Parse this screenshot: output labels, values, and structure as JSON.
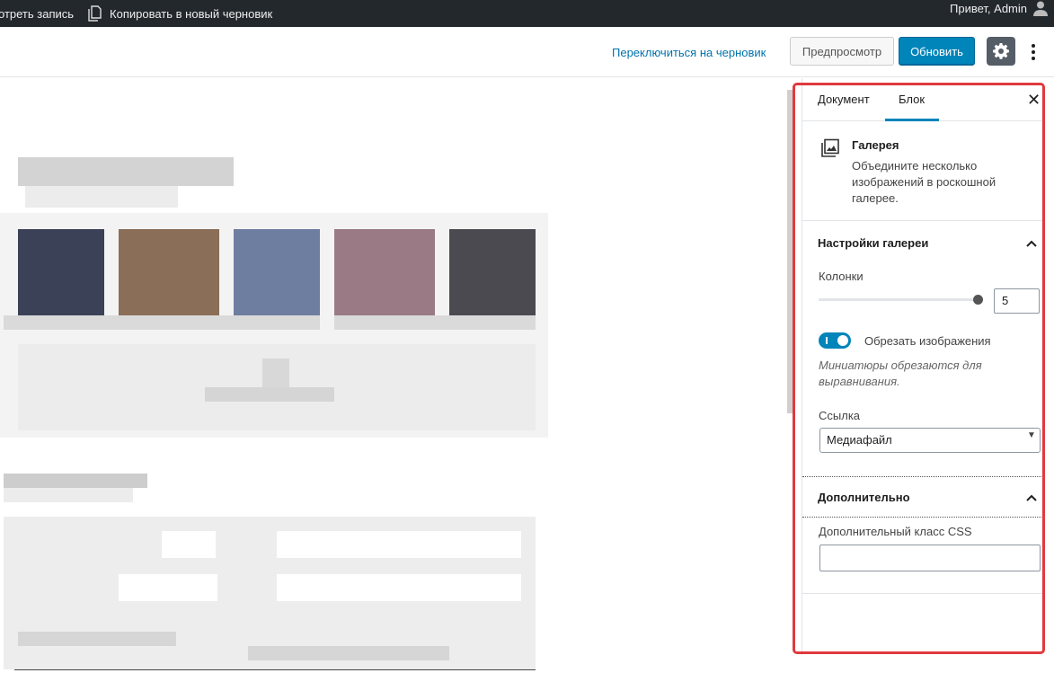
{
  "admin_bar": {
    "view_post": "отреть запись",
    "copy_draft": "Копировать в новый черновик",
    "greeting": "Привет, Admin",
    "icons": [
      "copy-icon",
      "user-icon"
    ]
  },
  "header": {
    "switch_draft": "Переключиться на черновик",
    "preview": "Предпросмотр",
    "update": "Обновить",
    "icons": [
      "gear-icon",
      "more-vertical-icon"
    ]
  },
  "sidebar": {
    "tabs": [
      "Документ",
      "Блок"
    ],
    "active_tab": "Блок",
    "close_icon": "close-icon",
    "block": {
      "icon": "gallery-icon",
      "title": "Галерея",
      "description": "Объедините несколько изображений в роскошной галерее."
    },
    "gallery_settings": {
      "title": "Настройки галереи",
      "columns_label": "Колонки",
      "columns_value": "5",
      "columns_level": 0.83,
      "crop_label": "Обрезать изображения",
      "crop_enabled": true,
      "crop_help": "Миниатюры обрезаются для выравнивания.",
      "link_label": "Ссылка",
      "link_value": "Медиафайл"
    },
    "advanced": {
      "title": "Дополнительно",
      "css_label": "Дополнительный класс CSS",
      "css_value": ""
    }
  },
  "colors": {
    "admin_bar_bg": "#23282d",
    "primary": "#0085ba",
    "link": "#0073aa",
    "highlight_frame": "#e03a3e"
  }
}
